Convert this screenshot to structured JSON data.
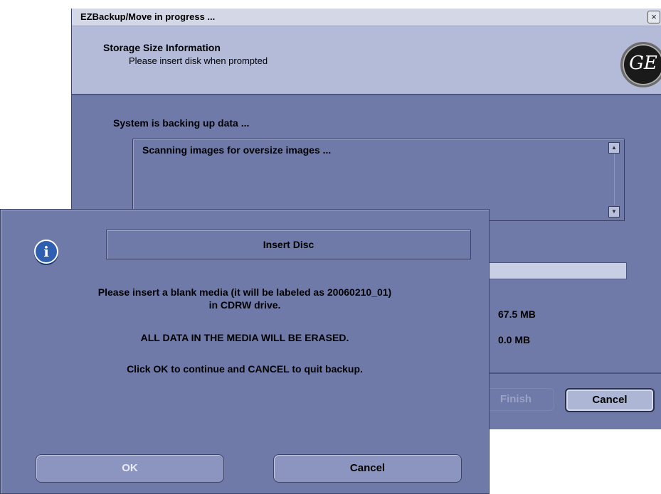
{
  "main_window": {
    "title": "EZBackup/Move in progress ...",
    "close_glyph": "×",
    "header": {
      "title": "Storage Size Information",
      "subtitle": "Please insert disk when prompted",
      "logo_text": "GE"
    },
    "status": "System is backing up data ...",
    "log": {
      "lines": [
        "Scanning images for oversize images ..."
      ],
      "scroll_up_glyph": "▲",
      "scroll_down_glyph": "▼"
    },
    "progress_fraction": 0,
    "sizes": {
      "total": "67.5 MB",
      "used": "0.0 MB"
    },
    "buttons": {
      "finish": "Finish",
      "cancel": "Cancel"
    }
  },
  "dialog": {
    "icon": "info-icon",
    "icon_glyph": "i",
    "title": "Insert Disc",
    "message_line1": "Please insert a blank media (it will be labeled as 20060210_01)",
    "message_line2": "in CDRW drive.",
    "message_warning": "ALL DATA IN THE MEDIA WILL BE ERASED.",
    "message_instructions": "Click OK to continue and CANCEL to quit backup.",
    "buttons": {
      "ok": "OK",
      "cancel": "Cancel"
    }
  },
  "colors": {
    "window_bg": "#6f7aa9",
    "header_bg": "#b3bbd9",
    "titlebar_bg": "#d4d8e6",
    "button_bg": "#8c95bf"
  }
}
